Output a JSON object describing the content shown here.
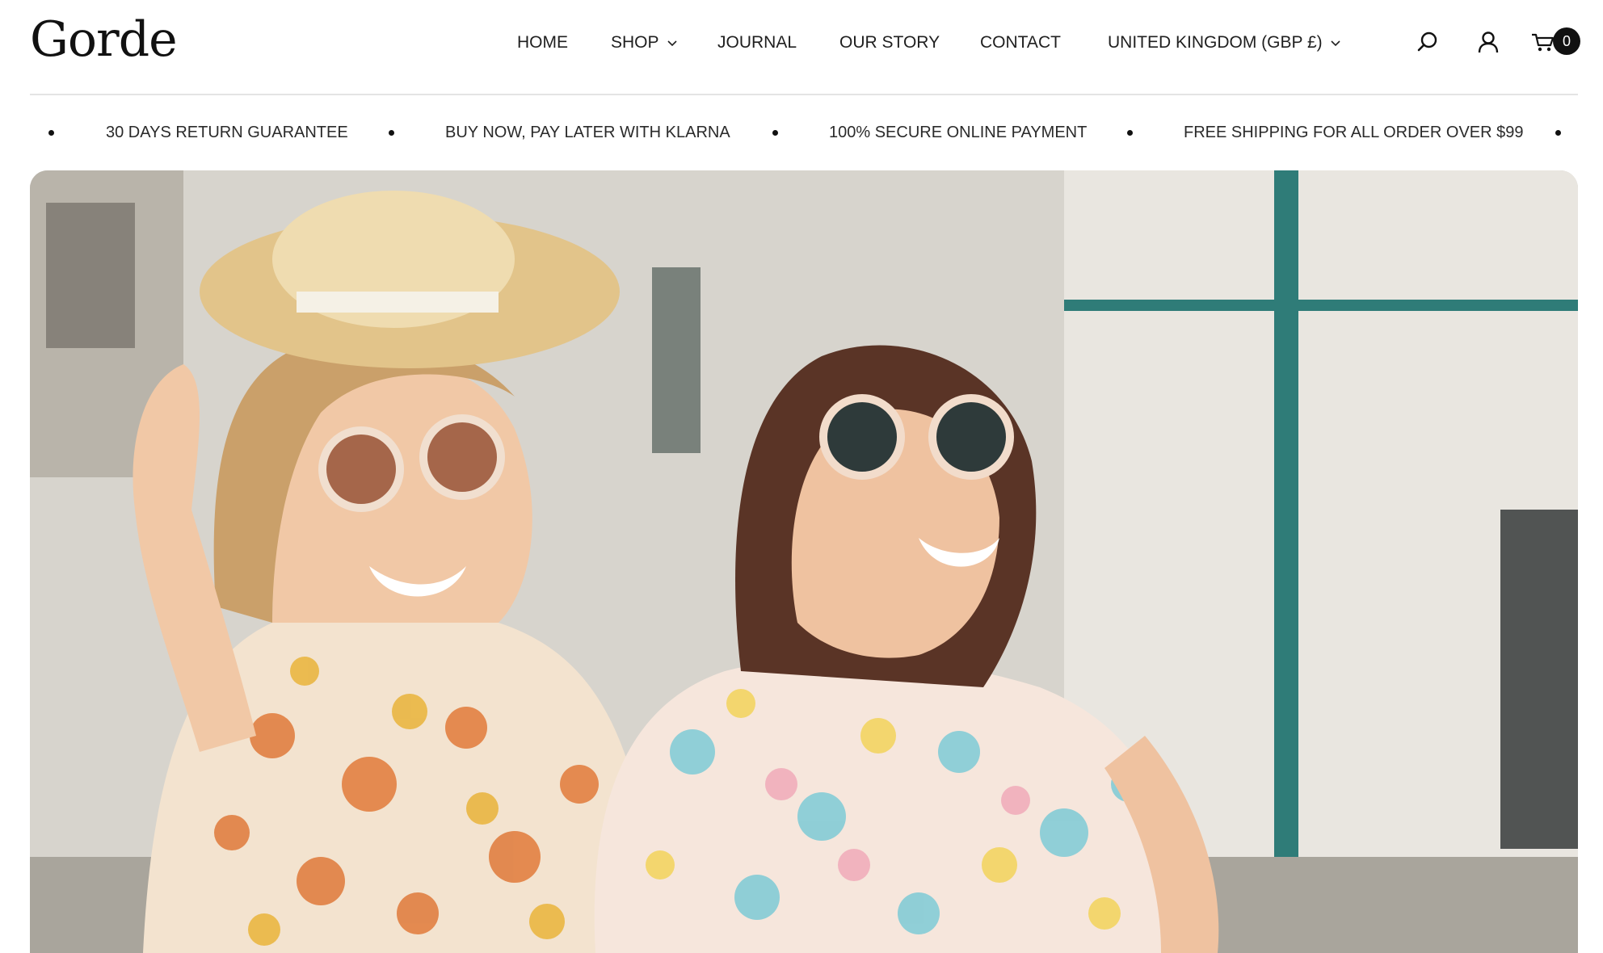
{
  "brand": {
    "logo_text": "Gorde"
  },
  "nav": {
    "items": [
      {
        "label": "HOME",
        "has_dropdown": false
      },
      {
        "label": "SHOP",
        "has_dropdown": true
      },
      {
        "label": "JOURNAL",
        "has_dropdown": false
      },
      {
        "label": "OUR STORY",
        "has_dropdown": false
      },
      {
        "label": "CONTACT",
        "has_dropdown": false
      }
    ],
    "locale": {
      "label": "UNITED KINGDOM (GBP £)",
      "has_dropdown": true
    }
  },
  "header_icons": {
    "search": "search-icon",
    "account": "user-icon",
    "cart": "cart-icon",
    "cart_count": "0"
  },
  "ticker": {
    "items": [
      "30 DAYS RETURN GUARANTEE",
      "BUY NOW, PAY LATER WITH KLARNA",
      "100% SECURE ONLINE PAYMENT",
      "FREE SHIPPING FOR ALL ORDER OVER $99"
    ]
  },
  "hero": {
    "image": "two smiling women in sunglasses and floral summer dresses"
  },
  "colors": {
    "text": "#1a1a1a",
    "badge_bg": "#111111",
    "divider": "#e4e4e4"
  }
}
